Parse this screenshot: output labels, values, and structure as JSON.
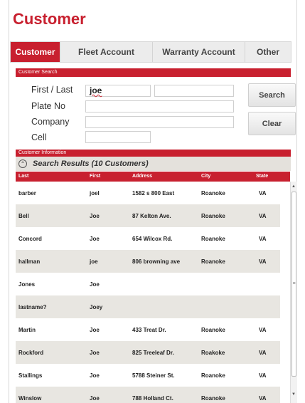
{
  "page": {
    "title": "Customer"
  },
  "tabs": [
    {
      "label": "Customer",
      "active": true
    },
    {
      "label": "Fleet Account",
      "active": false
    },
    {
      "label": "Warranty Account",
      "active": false
    },
    {
      "label": "Other",
      "active": false
    }
  ],
  "search": {
    "section_label": "Customer Search",
    "first_last_label": "First / Last",
    "first_value": "joe",
    "last_value": "",
    "plate_label": "Plate No",
    "plate_value": "",
    "company_label": "Company",
    "company_value": "",
    "cell_label": "Cell",
    "cell_value": "",
    "search_button": "Search",
    "clear_button": "Clear"
  },
  "info": {
    "section_label": "Customer Information"
  },
  "results": {
    "title": "Search Results (10 Customers)",
    "collapse_icon": "chevron-up-circle-icon",
    "columns": [
      "Last",
      "First",
      "Address",
      "City",
      "State"
    ],
    "rows": [
      {
        "last": "barber",
        "first": "joel",
        "address": "1582 s 800 East",
        "city": "Roanoke",
        "state": "VA"
      },
      {
        "last": "Bell",
        "first": "Joe",
        "address": "87 Kelton Ave.",
        "city": "Roanoke",
        "state": "VA"
      },
      {
        "last": "Concord",
        "first": "Joe",
        "address": "654 Wilcox Rd.",
        "city": "Roanoke",
        "state": "VA"
      },
      {
        "last": "hallman",
        "first": "joe",
        "address": "806 browning ave",
        "city": "Roanoke",
        "state": "VA"
      },
      {
        "last": "Jones",
        "first": "Joe",
        "address": "",
        "city": "",
        "state": ""
      },
      {
        "last": "lastname?",
        "first": "Joey",
        "address": "",
        "city": "",
        "state": ""
      },
      {
        "last": "Martin",
        "first": "Joe",
        "address": "433 Treat Dr.",
        "city": "Roanoke",
        "state": "VA"
      },
      {
        "last": "Rockford",
        "first": "Joe",
        "address": "825 Treeleaf Dr.",
        "city": "Roakoke",
        "state": "VA"
      },
      {
        "last": "Stallings",
        "first": "Joe",
        "address": "5788 Steiner St.",
        "city": "Roanoke",
        "state": "VA"
      },
      {
        "last": "Winslow",
        "first": "Joe",
        "address": "788 Holland Ct.",
        "city": "Roanoke",
        "state": "VA"
      }
    ]
  },
  "colors": {
    "accent": "#c8202f",
    "alt_row": "#e8e6e1",
    "tab_bg": "#ececec"
  }
}
